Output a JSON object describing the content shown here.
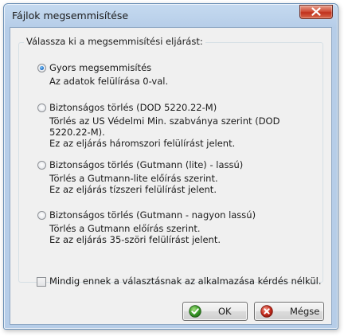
{
  "dialog": {
    "title": "Fájlok megsemmisítése",
    "close_label": "Close"
  },
  "group": {
    "legend": "Válassza ki a megsemmisítési eljárást:"
  },
  "options": [
    {
      "label": "Gyors megsemmisítés",
      "desc": [
        "Az adatok felülírása 0-val."
      ],
      "checked": true
    },
    {
      "label": "Biztonságos törlés (DOD 5220.22-M)",
      "desc": [
        "Törlés az US Védelmi Min. szabványa szerint (DOD",
        "5220.22-M).",
        "Ez az eljárás háromszori felülírást jelent."
      ],
      "checked": false
    },
    {
      "label": "Biztonságos törlés (Gutmann (lite) - lassú)",
      "desc": [
        "Törlés a Gutmann-lite előírás szerint.",
        "Ez az eljárás tízszeri felülírást jelent."
      ],
      "checked": false
    },
    {
      "label": "Biztonságos törlés (Gutmann - nagyon lassú)",
      "desc": [
        "Törlés a Gutmann előírás szerint.",
        "Ez az eljárás 35-szöri felülírást jelent."
      ],
      "checked": false
    }
  ],
  "remember_checkbox": {
    "label": "Mindig ennek a választásnak az alkalmazása kérdés nélkül.",
    "checked": false
  },
  "buttons": {
    "ok_label": "OK",
    "cancel_label": "Mégse"
  },
  "colors": {
    "titlebar": "#b6cde8",
    "close_button": "#c9412b",
    "ok_icon": "#3a9a2a",
    "cancel_icon": "#c72c1e"
  },
  "icons": {
    "close": "close-icon",
    "ok": "checkmark-icon",
    "cancel": "cancel-icon"
  }
}
